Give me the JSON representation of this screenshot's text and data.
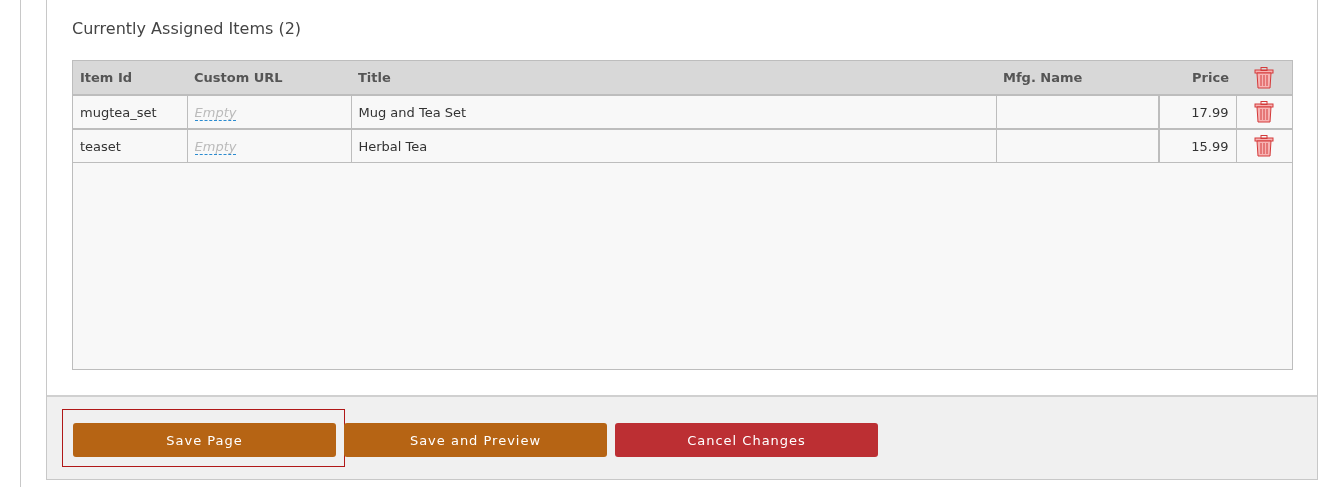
{
  "section": {
    "title": "Currently Assigned Items (2)"
  },
  "table": {
    "columns": [
      "Item Id",
      "Custom URL",
      "Title",
      "Mfg. Name",
      "Price"
    ],
    "rows": [
      {
        "item_id": "mugtea_set",
        "custom_url": "Empty",
        "title": "Mug and Tea Set",
        "mfg_name": "",
        "price": "17.99"
      },
      {
        "item_id": "teaset",
        "custom_url": "Empty",
        "title": "Herbal Tea",
        "mfg_name": "",
        "price": "15.99"
      }
    ]
  },
  "buttons": [
    {
      "label": "Save Page",
      "kind": "primary",
      "focused": true
    },
    {
      "label": "Save and Preview",
      "kind": "primary",
      "focused": false
    },
    {
      "label": "Cancel Changes",
      "kind": "danger",
      "focused": false
    }
  ]
}
